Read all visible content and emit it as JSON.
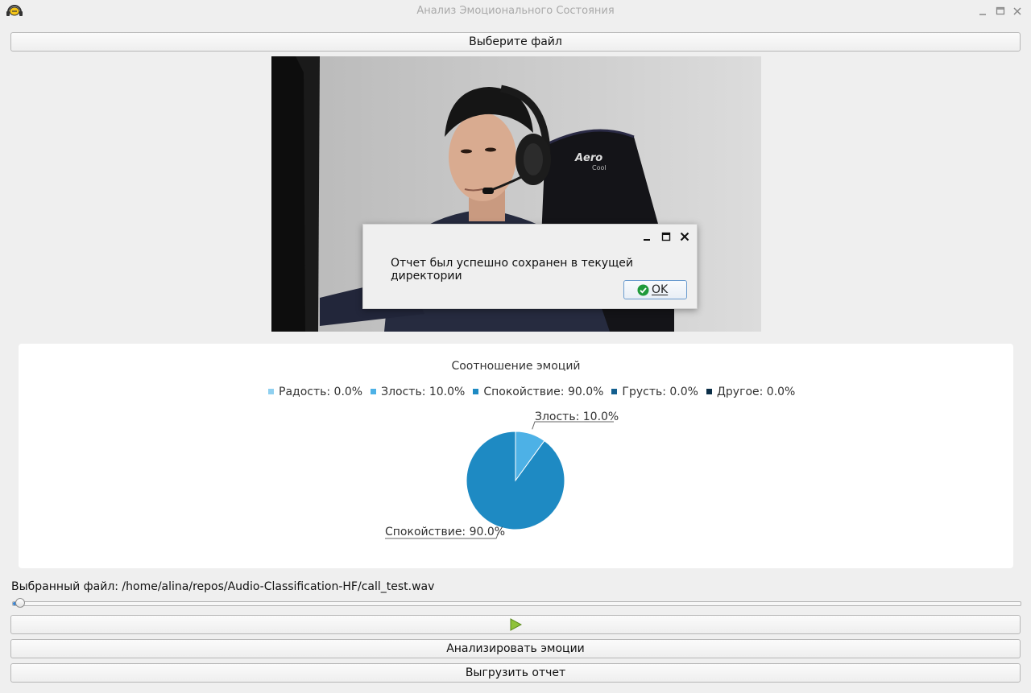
{
  "window": {
    "title": "Анализ Эмоционального Состояния"
  },
  "buttons": {
    "choose_file": "Выберите файл",
    "analyze": "Анализировать эмоции",
    "export_report": "Выгрузить отчет"
  },
  "video": {
    "chair_brand": "Aero",
    "chair_brand_sub": "Cool"
  },
  "dialog": {
    "message": "Отчет был успешно сохранен в текущей директории",
    "ok_label": "OK"
  },
  "chart_data": {
    "type": "pie",
    "title": "Соотношение эмоций",
    "legend_position": "top",
    "slices": [
      {
        "legend": "Радость: 0.0%",
        "label": "",
        "value": 0.0,
        "color": "#8fd0f0"
      },
      {
        "legend": "Злость: 10.0%",
        "label": "Злость: 10.0%",
        "value": 10.0,
        "color": "#4db1e6"
      },
      {
        "legend": "Спокойствие: 90.0%",
        "label": "Спокойствие: 90.0%",
        "value": 90.0,
        "color": "#1e8ac3"
      },
      {
        "legend": "Грусть: 0.0%",
        "label": "",
        "value": 0.0,
        "color": "#135f8f"
      },
      {
        "legend": "Другое: 0.0%",
        "label": "",
        "value": 0.0,
        "color": "#0b2e47"
      }
    ]
  },
  "file": {
    "label": "Выбранный файл: /home/alina/repos/Audio-Classification-HF/call_test.wav"
  },
  "player": {
    "progress": 0.005
  },
  "icons": {
    "app": "headset-icon",
    "minimize": "minimize-icon",
    "maximize": "maximize-icon",
    "close": "close-icon",
    "ok": "check-circle-icon",
    "play": "play-icon"
  }
}
